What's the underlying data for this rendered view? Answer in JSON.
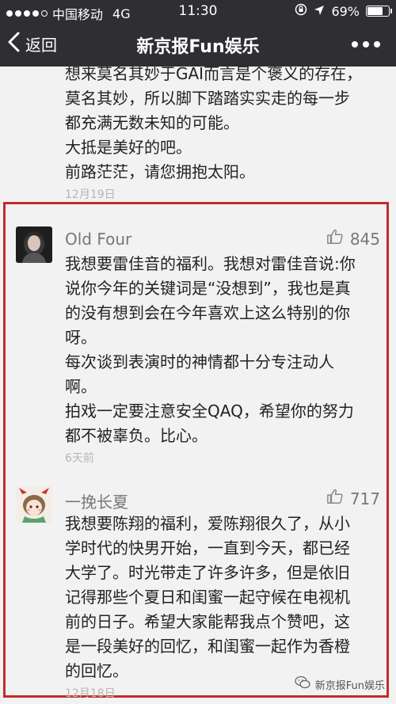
{
  "status_bar": {
    "carrier": "中国移动",
    "network": "4G",
    "time": "11:30",
    "battery": "69%",
    "battery_level": 0.69
  },
  "nav": {
    "back_label": "返回",
    "title": "新京报Fun娱乐"
  },
  "comments": [
    {
      "lines": [
        "想来莫名其妙于GAI而言是个褒义的存在，",
        "莫名其妙，所以脚下踏踏实实走的每一步",
        "都充满无数未知的可能。",
        "大抵是美好的吧。",
        "前路茫茫，请您拥抱太阳。"
      ],
      "date": "12月19日"
    },
    {
      "nickname": "Old Four",
      "likes": "845",
      "lines": [
        "我想要雷佳音的福利。我想对雷佳音说:你",
        "说你今年的关键词是“没想到”，我也是真",
        "的没有想到会在今年喜欢上这么特别的你",
        "呀。",
        "每次谈到表演时的神情都十分专注动人",
        "啊。",
        "拍戏一定要注意安全QAQ，希望你的努力",
        "都不被辜负。比心。"
      ],
      "date": "6天前"
    },
    {
      "nickname": "一挽长夏",
      "likes": "717",
      "lines": [
        "我想要陈翔的福利，爱陈翔很久了，从小",
        "学时代的快男开始，一直到今天，都已经",
        "大学了。时光带走了许多许多，但是依旧",
        "记得那些个夏日和闺蜜一起守候在电视机",
        "前的日子。希望大家能帮我点个赞吧，这",
        "是一段美好的回忆，和闺蜜一起作为香橙",
        "的回忆。"
      ],
      "date": "12月18日"
    }
  ],
  "watermark": "新京报Fun娱乐",
  "colors": {
    "bar_bg": "#2f2f33",
    "page_bg": "#f2f2f2",
    "highlight_border": "#c32b2b"
  }
}
